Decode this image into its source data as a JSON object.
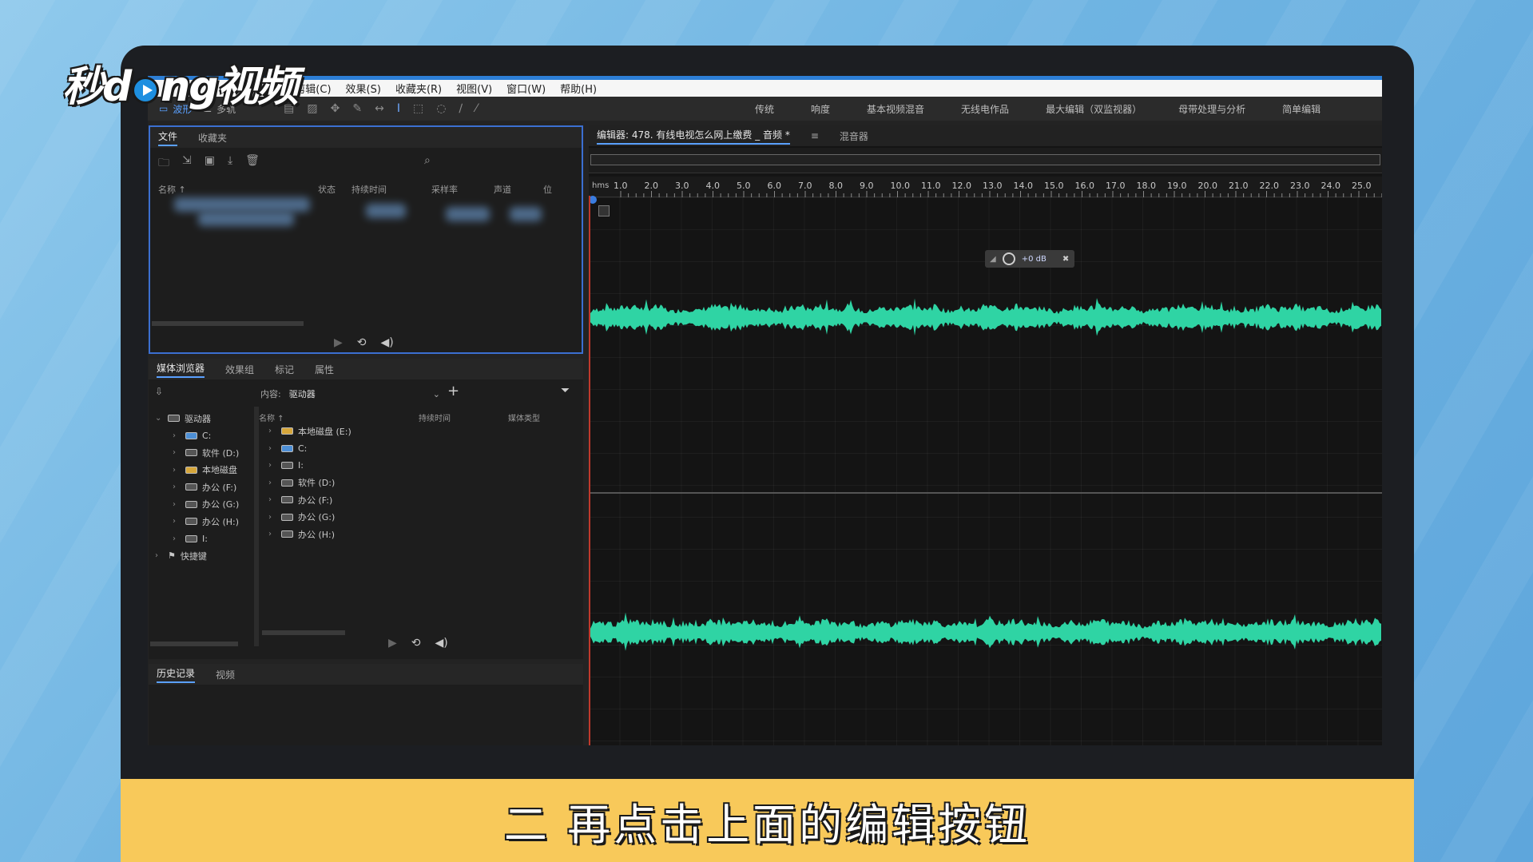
{
  "watermark": {
    "text_a": "秒d",
    "text_b": "ng视频"
  },
  "menu": [
    "M)",
    "剪辑(C)",
    "效果(S)",
    "收藏夹(R)",
    "视图(V)",
    "窗口(W)",
    "帮助(H)"
  ],
  "toolbar": {
    "modes": [
      {
        "label": "波形",
        "icon": "waveform-mode-icon"
      },
      {
        "label": "多轨",
        "icon": "multitrack-mode-icon"
      }
    ],
    "workspaces": [
      "传统",
      "响度",
      "基本视频混音",
      "无线电作品",
      "最大编辑（双监视器）",
      "母带处理与分析",
      "简单编辑"
    ]
  },
  "files_panel": {
    "tabs": [
      "文件",
      "收藏夹"
    ],
    "columns": [
      "名称 ↑",
      "状态",
      "持续时间",
      "采样率",
      "声道",
      "位"
    ]
  },
  "media_panel": {
    "tabs": [
      "媒体浏览器",
      "效果组",
      "标记",
      "属性"
    ],
    "content_label": "内容:",
    "content_value": "驱动器",
    "columns": [
      "名称 ↑",
      "持续时间",
      "媒体类型"
    ],
    "tree": [
      {
        "label": "驱动器",
        "icon": "drive-icon"
      },
      {
        "label": "C:",
        "icon": "windows-drive-icon"
      },
      {
        "label": "软件 (D:)",
        "icon": "drive-icon"
      },
      {
        "label": "本地磁盘",
        "icon": "locked-drive-icon"
      },
      {
        "label": "办公 (F:)",
        "icon": "drive-icon"
      },
      {
        "label": "办公 (G:)",
        "icon": "drive-icon"
      },
      {
        "label": "办公 (H:)",
        "icon": "drive-icon"
      },
      {
        "label": "I:",
        "icon": "drive-icon"
      },
      {
        "label": "快捷键",
        "icon": "flag-icon"
      }
    ],
    "list": [
      {
        "label": "本地磁盘 (E:)",
        "icon": "locked-drive-icon"
      },
      {
        "label": "C:",
        "icon": "windows-drive-icon"
      },
      {
        "label": "I:",
        "icon": "drive-icon"
      },
      {
        "label": "软件 (D:)",
        "icon": "drive-icon"
      },
      {
        "label": "办公 (F:)",
        "icon": "drive-icon"
      },
      {
        "label": "办公 (G:)",
        "icon": "drive-icon"
      },
      {
        "label": "办公 (H:)",
        "icon": "drive-icon"
      }
    ]
  },
  "history_panel": {
    "tabs": [
      "历史记录",
      "视频"
    ]
  },
  "editor": {
    "tab_title": "编辑器: 478. 有线电视怎么网上缴费 _ 音频 *",
    "mixer_tab": "混音器",
    "ruler_unit": "hms",
    "ruler_ticks": [
      "1.0",
      "2.0",
      "3.0",
      "4.0",
      "5.0",
      "6.0",
      "7.0",
      "8.0",
      "9.0",
      "10.0",
      "11.0",
      "12.0",
      "13.0",
      "14.0",
      "15.0",
      "16.0",
      "17.0",
      "18.0",
      "19.0",
      "20.0",
      "21.0",
      "22.0",
      "23.0",
      "24.0",
      "25.0"
    ],
    "hud_gain": "+0 dB",
    "waveform_color": "#2fd4a4"
  },
  "caption": "二 再点击上面的编辑按钮"
}
